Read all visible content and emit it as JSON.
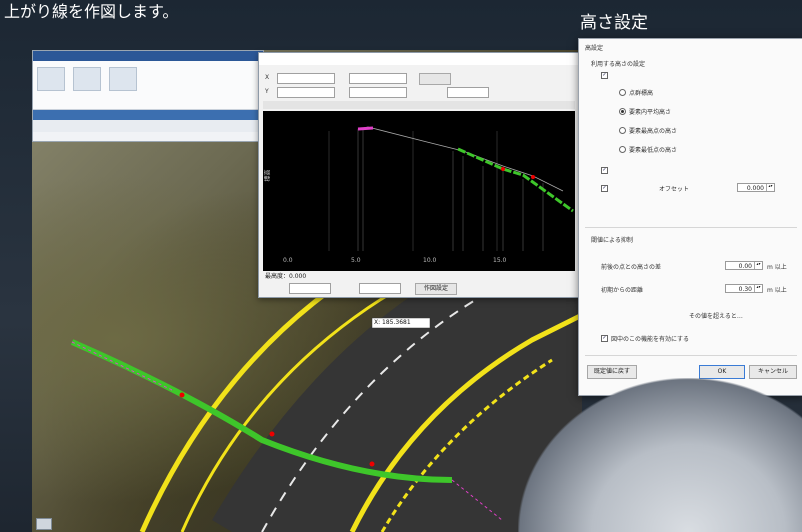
{
  "captions": {
    "left": "上がり線を作図します。",
    "right": "高さ設定"
  },
  "profile_dialog": {
    "field_x_label": "X",
    "field_y_label": "Y",
    "plot_ylabel": "標高",
    "x_ticks": [
      "0.0",
      "5.0",
      "10.0",
      "15.0"
    ],
    "status": "最高度：0.000",
    "bottom_btn": "作図設定"
  },
  "height_dialog": {
    "title": "高設定",
    "section1": "利用する高さの設定",
    "radio_options": [
      "点群標高",
      "要素内平均高さ",
      "要素最高点の高さ",
      "要素最低点の高さ"
    ],
    "offset_label": "オフセット",
    "offset_value": "0.000",
    "section2": "閾値による抑制",
    "threshold1_label": "前後の点との高さの差",
    "threshold1_value": "0.00",
    "threshold2_label": "初期からの距離",
    "threshold2_value": "0.30",
    "unit": "m 以上",
    "footnote": "その値を超えると…",
    "checkbox_bottom": "図中のこの機能を有効にする",
    "btn_defaults": "既定値に戻す",
    "btn_ok": "OK",
    "btn_cancel": "キャンセル"
  },
  "map": {
    "label_tag": "X: 185.3681"
  },
  "colors": {
    "yellow_lines": "#f2e21a",
    "green_profile": "#3ec62a",
    "magenta": "#e040c8"
  }
}
